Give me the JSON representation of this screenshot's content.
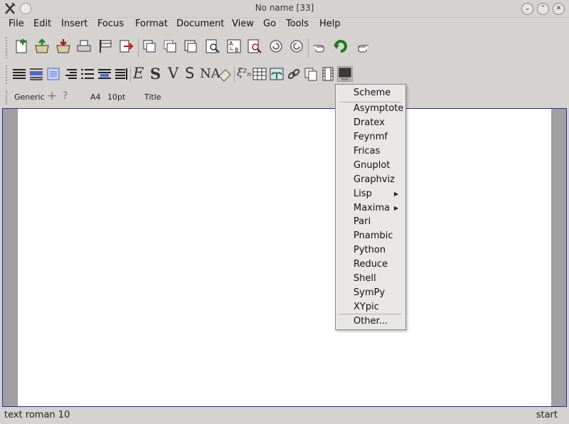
{
  "window": {
    "title": "No name [33]"
  },
  "menubar": {
    "items": [
      "File",
      "Edit",
      "Insert",
      "Focus",
      "Format",
      "Document",
      "View",
      "Go",
      "Tools",
      "Help"
    ]
  },
  "style_toolbar": {
    "style": "Generic",
    "add": "+",
    "help": "?",
    "paper": "A4",
    "font_size": "10pt",
    "title": "Title"
  },
  "popup": {
    "items": [
      "Scheme",
      "Asymptote",
      "Dratex",
      "Feynmf",
      "Fricas",
      "Gnuplot",
      "Graphviz",
      "Lisp",
      "Maxima",
      "Pari",
      "Pnambic",
      "Python",
      "Reduce",
      "Shell",
      "SymPy",
      "XYpic",
      "Other..."
    ]
  },
  "status": {
    "left": "text roman 10",
    "right": "start"
  },
  "toolbar2": {
    "e": "E",
    "s": "S",
    "v": "V",
    "s2": "S",
    "na": "NA",
    "formula": "ξ²ₙ"
  },
  "colors": {
    "accent": "#2a2e7a",
    "page": "#ffffff",
    "margin": "#9f9f9f",
    "chrome": "#d6d2d0"
  }
}
